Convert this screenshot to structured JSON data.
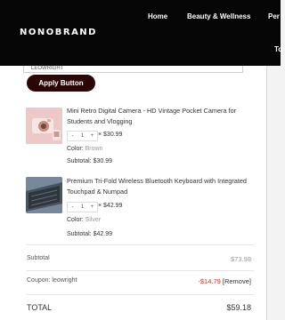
{
  "header": {
    "logo": "NONOBRAND",
    "nav": [
      "Home",
      "Beauty & Wellness",
      "Per"
    ],
    "nav_second_row": "To"
  },
  "coupon": {
    "input_value": "LEOWRIGHT",
    "apply_label": "Apply Button"
  },
  "items": [
    {
      "title": "Mini Retro Digital Camera - HD Vintage Pocket Camera for Students and Vlogging",
      "qty_minus": "-",
      "qty_value": "1",
      "qty_plus": "+",
      "price": "× $30.99",
      "color_label": "Color:",
      "color_value": "Brown",
      "subtotal_label": "Subtotal:",
      "subtotal_value": "$30.99"
    },
    {
      "title": "Premium Tri-Fold Wireless Bluetooth Keyboard with Integrated Touchpad & Numpad",
      "qty_minus": "-",
      "qty_value": "1",
      "qty_plus": "+",
      "price": "× $42.99",
      "color_label": "Color:",
      "color_value": "Silver",
      "subtotal_label": "Subtotal:",
      "subtotal_value": "$42.99"
    }
  ],
  "summary": {
    "subtotal_label": "Subtotal",
    "subtotal_value": "$73.98",
    "coupon_label": "Coupon: leowright",
    "coupon_value": "-$14.79",
    "remove_label": "[Remove]",
    "total_label": "TOTAL",
    "total_value": "$59.18"
  },
  "colors": {
    "header_bg": "#050505",
    "button_bg": "#2a0707",
    "discount": "#c0392b"
  }
}
